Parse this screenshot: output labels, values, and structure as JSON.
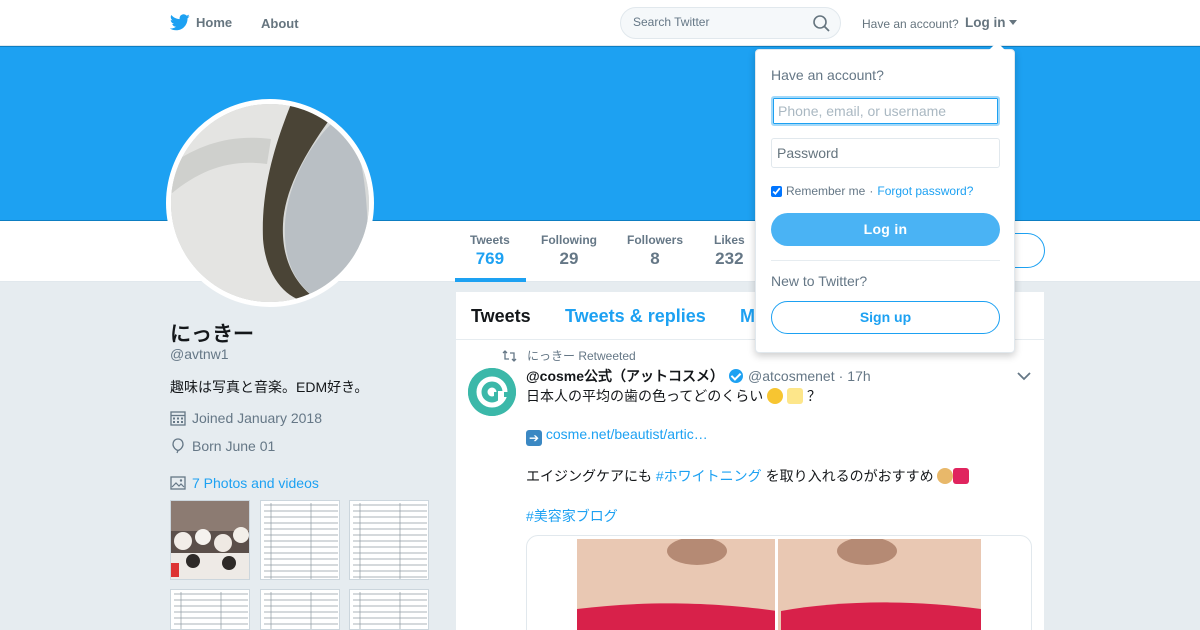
{
  "nav": {
    "home_label": "Home",
    "about_label": "About",
    "search_placeholder": "Search Twitter",
    "have_account": "Have an account?",
    "login_label": "Log in"
  },
  "colors": {
    "brand": "#1da1f2",
    "banner": "#1da1f2",
    "text_secondary": "#657786"
  },
  "icons": {
    "brand": "twitter-bird-icon",
    "search": "search-icon",
    "calendar": "calendar-icon",
    "balloon": "balloon-icon",
    "photo": "photo-icon",
    "retweet": "retweet-icon",
    "verified": "verified-badge-icon",
    "caret": "chevron-down-icon"
  },
  "profile_nav": {
    "stats": [
      {
        "label": "Tweets",
        "value": "769"
      },
      {
        "label": "Following",
        "value": "29"
      },
      {
        "label": "Followers",
        "value": "8"
      },
      {
        "label": "Likes",
        "value": "232"
      }
    ]
  },
  "profile": {
    "name": "にっきー",
    "handle": "@avtnw1",
    "bio": "趣味は写真と音楽。EDM好き。",
    "joined": "Joined January 2018",
    "born": "Born June 01",
    "photos_link": "7 Photos and videos"
  },
  "timeline": {
    "tabs": [
      "Tweets",
      "Tweets & replies",
      "M"
    ],
    "retweet_by": "にっきー Retweeted",
    "tweet": {
      "author_name": "@cosme公式（アットコスメ）",
      "author_handle": "@atcosmenet",
      "time": "17h",
      "line1": "日本人の平均の歯の色ってどのくらい",
      "line1_end": "？",
      "line2_link": "cosme.net/beautist/artic…",
      "line3_pre": "エイジングケアにも ",
      "line3_tag": "#ホワイトニング",
      "line3_post": " を取り入れるのがおすすめ",
      "line4_tag": "#美容家ブログ"
    }
  },
  "login_dropdown": {
    "title": "Have an account?",
    "username_placeholder": "Phone, email, or username",
    "password_placeholder": "Password",
    "remember": "Remember me",
    "separator": "·",
    "forgot": "Forgot password?",
    "login_button": "Log in",
    "new_to": "New to Twitter?",
    "signup_button": "Sign up"
  }
}
